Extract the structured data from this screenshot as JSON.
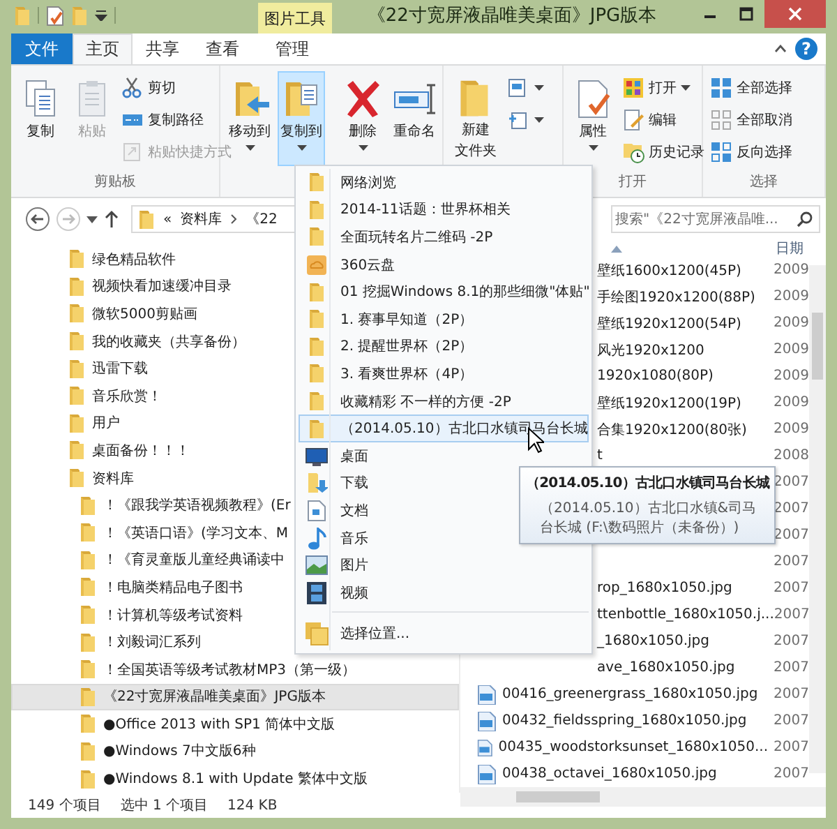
{
  "window": {
    "title": "《22寸宽屏液晶唯美桌面》JPG版本",
    "contextual_label": "图片工具"
  },
  "ribbon": {
    "file_tab": "文件",
    "help": "?",
    "tabs": [
      {
        "label": "主页",
        "selected": true
      },
      {
        "label": "共享",
        "selected": false
      },
      {
        "label": "查看",
        "selected": false
      },
      {
        "label": "管理",
        "selected": false
      }
    ],
    "groups": [
      {
        "label": "剪贴板",
        "items": [
          {
            "kind": "large",
            "label": "复制",
            "disabled": false,
            "pressed": false,
            "dropdown": false
          },
          {
            "kind": "large",
            "label": "粘贴",
            "disabled": true,
            "pressed": false,
            "dropdown": false
          },
          {
            "kind": "small",
            "label": "剪切",
            "disabled": false,
            "dropdown": false
          },
          {
            "kind": "small",
            "label": "复制路径",
            "disabled": false,
            "dropdown": false
          },
          {
            "kind": "small",
            "label": "粘贴快捷方式",
            "disabled": true,
            "dropdown": false
          }
        ]
      },
      {
        "items": [
          {
            "kind": "large",
            "label": "移动到",
            "disabled": false,
            "pressed": false,
            "dropdown": true
          },
          {
            "kind": "large",
            "label": "复制到",
            "disabled": false,
            "pressed": true,
            "dropdown": true
          },
          {
            "kind": "separator"
          },
          {
            "kind": "large",
            "label": "删除",
            "disabled": false,
            "pressed": false,
            "dropdown": true
          },
          {
            "kind": "large",
            "label": "重命名",
            "disabled": false,
            "pressed": false,
            "dropdown": false
          }
        ]
      },
      {
        "items": [
          {
            "kind": "large",
            "label": [
              "新建",
              "文件夹"
            ],
            "disabled": false,
            "pressed": false,
            "dropdown": false
          },
          {
            "kind": "small",
            "disabled": false,
            "dropdown": true
          },
          {
            "kind": "small",
            "disabled": false,
            "dropdown": true
          }
        ]
      },
      {
        "label": "打开",
        "items": [
          {
            "kind": "large",
            "label": "属性",
            "disabled": false,
            "pressed": false,
            "dropdown": true
          },
          {
            "kind": "small",
            "label": "打开",
            "disabled": false,
            "dropdown": true
          },
          {
            "kind": "small",
            "label": "编辑",
            "disabled": false,
            "dropdown": false
          },
          {
            "kind": "small",
            "label": "历史记录",
            "disabled": false,
            "dropdown": false
          }
        ]
      },
      {
        "label": "选择",
        "items": [
          {
            "kind": "small",
            "label": "全部选择",
            "disabled": false,
            "dropdown": false
          },
          {
            "kind": "small",
            "label": "全部取消",
            "disabled": false,
            "dropdown": false
          },
          {
            "kind": "small",
            "label": "反向选择",
            "disabled": false,
            "dropdown": false
          }
        ]
      }
    ]
  },
  "address": {
    "overflow": "«",
    "crumbs": [
      "资料库",
      "《22"
    ]
  },
  "search": {
    "placeholder": "搜索\"《22寸宽屏液晶唯..."
  },
  "navigation": {
    "items": [
      {
        "label": "绿色精品软件",
        "selected": false
      },
      {
        "label": "视频快看加速缓冲目录",
        "selected": false
      },
      {
        "label": "微软5000剪贴画",
        "selected": false
      },
      {
        "label": "我的收藏夹（共享备份）",
        "selected": false
      },
      {
        "label": "迅雷下载",
        "selected": false
      },
      {
        "label": "音乐欣赏！",
        "selected": false
      },
      {
        "label": "用户",
        "selected": false
      },
      {
        "label": "桌面备份！！！",
        "selected": false
      },
      {
        "label": "资料库",
        "selected": false,
        "children": [
          {
            "label": "！《跟我学英语视频教程》(Er",
            "selected": false
          },
          {
            "label": "！《英语口语》(学习文本、M",
            "selected": false
          },
          {
            "label": "！《育灵童版儿童经典诵读中",
            "selected": false
          },
          {
            "label": "！电脑类精品电子图书",
            "selected": false
          },
          {
            "label": "！计算机等级考试资料",
            "selected": false
          },
          {
            "label": "！刘毅词汇系列",
            "selected": false
          },
          {
            "label": "！全国英语等级考试教材MP3（第一级）",
            "selected": false
          },
          {
            "label": "《22寸宽屏液晶唯美桌面》JPG版本",
            "selected": true
          },
          {
            "label": "●Office 2013 with SP1 简体中文版",
            "selected": false
          },
          {
            "label": "●Windows 7中文版6种",
            "selected": false
          },
          {
            "label": "●Windows 8.1 with Update 繁体中文版",
            "selected": false
          }
        ]
      }
    ]
  },
  "file_list": {
    "columns": [
      {
        "label": "日期"
      }
    ],
    "rows": [
      {
        "kind": "partial",
        "name": "壁纸1600x1200(45P)",
        "date": "2009"
      },
      {
        "kind": "partial",
        "name": "手绘图1920x1200(88P)",
        "date": "2009"
      },
      {
        "kind": "partial",
        "name": "壁纸1920x1200(54P)",
        "date": "2009"
      },
      {
        "kind": "partial",
        "name": "风光1920x1200",
        "date": "2009"
      },
      {
        "kind": "partial",
        "name": "1920x1080(80P)",
        "date": "2009"
      },
      {
        "kind": "partial",
        "name": "壁纸1920x1200(19P)",
        "date": "2009"
      },
      {
        "kind": "partial",
        "name": "合集1920x1200(80张)",
        "date": "2009"
      },
      {
        "kind": "partial",
        "name": "t",
        "date": "2008"
      },
      {
        "kind": "partial",
        "date": "2007"
      },
      {
        "kind": "partial",
        "date": "2007"
      },
      {
        "kind": "partial",
        "date": "2007"
      },
      {
        "kind": "partial",
        "date": "2007"
      },
      {
        "kind": "partial",
        "name": "rop_1680x1050.jpg",
        "date": "2007"
      },
      {
        "kind": "partial",
        "name": "ttenbottle_1680x1050.j...",
        "date": "2007"
      },
      {
        "kind": "partial",
        "name": "_1680x1050.jpg",
        "date": "2007"
      },
      {
        "kind": "partial",
        "name": "ave_1680x1050.jpg",
        "date": "2007"
      },
      {
        "kind": "full",
        "name": "00416_greenergrass_1680x1050.jpg",
        "date": "2007"
      },
      {
        "kind": "full",
        "name": "00432_fieldsspring_1680x1050.jpg",
        "date": "2007"
      },
      {
        "kind": "full",
        "name": "00435_woodstorksunset_1680x1050...",
        "date": "2007"
      },
      {
        "kind": "full",
        "name": "00438_octavei_1680x1050.jpg",
        "date": "2007"
      }
    ]
  },
  "copy_to_menu": {
    "items": [
      {
        "kind": "folder",
        "label": "网络浏览",
        "highlighted": false
      },
      {
        "kind": "folder",
        "label": "2014-11话题：世界杯相关",
        "highlighted": false
      },
      {
        "kind": "folder",
        "label": "全面玩转名片二维码 -2P",
        "highlighted": false
      },
      {
        "kind": "cloud",
        "label": "360云盘",
        "highlighted": false
      },
      {
        "kind": "folder",
        "label": "01 挖掘Windows 8.1的那些细微\"体贴\"",
        "highlighted": false
      },
      {
        "kind": "folder",
        "label": "1. 赛事早知道（2P）",
        "highlighted": false
      },
      {
        "kind": "folder",
        "label": "2. 提醒世界杯（2P）",
        "highlighted": false
      },
      {
        "kind": "folder",
        "label": "3. 看爽世界杯（4P）",
        "highlighted": false
      },
      {
        "kind": "folder",
        "label": "收藏精彩 不一样的方便 -2P",
        "highlighted": false
      },
      {
        "kind": "folder",
        "label": "（2014.05.10）古北口水镇司马台长城",
        "highlighted": true
      },
      {
        "kind": "desktop",
        "label": "桌面",
        "highlighted": false
      },
      {
        "kind": "download",
        "label": "下载",
        "highlighted": false
      },
      {
        "kind": "document",
        "label": "文档",
        "highlighted": false
      },
      {
        "kind": "music",
        "label": "音乐",
        "highlighted": false
      },
      {
        "kind": "picture",
        "label": "图片",
        "highlighted": false
      },
      {
        "kind": "video",
        "label": "视频",
        "highlighted": false
      },
      {
        "kind": "separator"
      },
      {
        "kind": "choose",
        "label": "选择位置...",
        "highlighted": false
      }
    ]
  },
  "tooltip": {
    "title": "（2014.05.10）古北口水镇司马台长城",
    "text": "（2014.05.10）古北口水镇&司马台长城 (F:\\数码照片（未备份）)"
  },
  "status_bar": {
    "item_count": "149 个项目",
    "selection": "选中 1 个项目",
    "size": "124 KB"
  }
}
